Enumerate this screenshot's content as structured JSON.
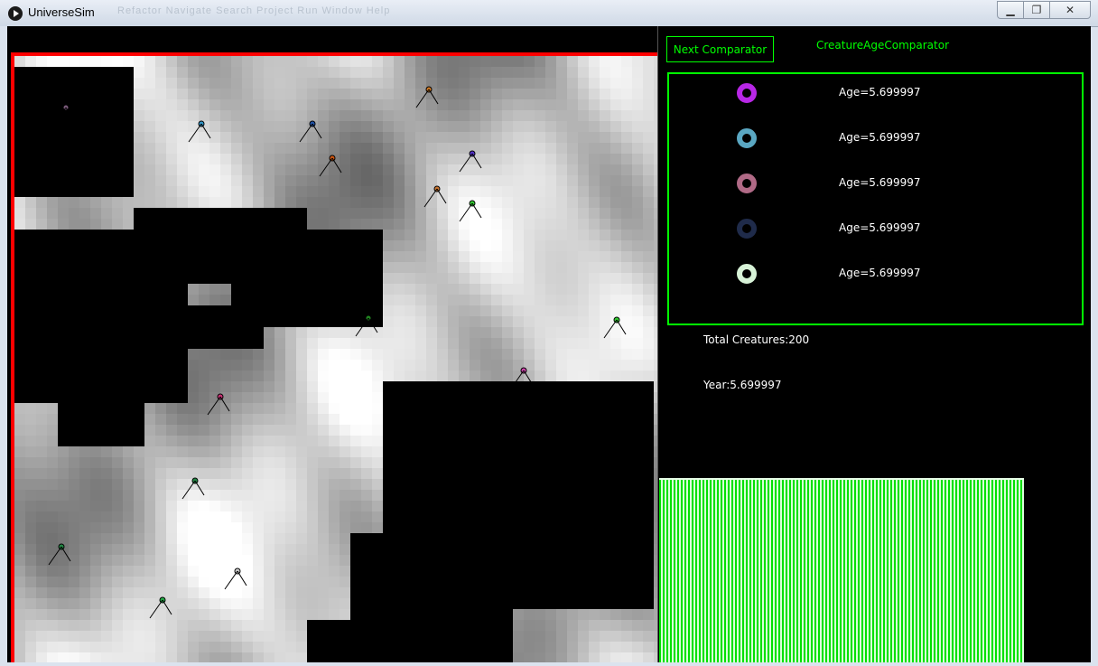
{
  "window": {
    "title": "UniverseSim",
    "ghost_menu": "Refactor   Navigate   Search   Project   Run   Window   Help"
  },
  "controls": {
    "next_comparator_label": "Next Comparator",
    "comparator_name": "CreatureAgeComparator"
  },
  "top_creatures": [
    {
      "age_label": "Age=5.699997",
      "color": "#b827e6"
    },
    {
      "age_label": "Age=5.699997",
      "color": "#5aa7c2"
    },
    {
      "age_label": "Age=5.699997",
      "color": "#b06a86"
    },
    {
      "age_label": "Age=5.699997",
      "color": "#1f2b4a"
    },
    {
      "age_label": "Age=5.699997",
      "color": "#d7f2d7"
    }
  ],
  "stats": {
    "total_creatures": "Total Creatures:200",
    "year": "Year:5.699997"
  },
  "colors": {
    "accent": "#00ff00",
    "border_red": "#ff0000",
    "background": "#000000"
  },
  "icons": [
    "play-icon",
    "minimize-icon",
    "restore-icon",
    "close-icon"
  ]
}
